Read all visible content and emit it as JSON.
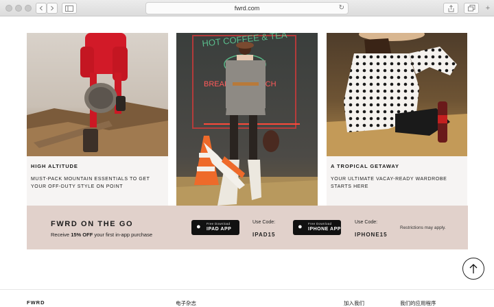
{
  "browser": {
    "url": "fwrd.com",
    "back_icon": "chevron-left-icon",
    "forward_icon": "chevron-right-icon",
    "sidebar_icon": "sidebar-icon",
    "reload_icon": "reload-icon",
    "share_icon": "share-icon",
    "tabs_icon": "tabs-icon",
    "new_tab_icon": "plus-icon"
  },
  "cards": [
    {
      "title": "HIGH ALTITUDE",
      "text": "MUST-PACK MOUNTAIN ESSENTIALS TO GET YOUR OFF-DUTY STYLE ON POINT"
    },
    {
      "neon_top": "HOT COFFEE & TEA",
      "neon_bottom": "BREAKFAST LUNCH"
    },
    {
      "title": "A TROPICAL GETAWAY",
      "text": "YOUR ULTIMATE VACAY-READY WARDROBE STARTS HERE"
    }
  ],
  "promo": {
    "title": "FWRD ON THE GO",
    "sub_prefix": "Receive ",
    "sub_bold": "15% OFF",
    "sub_suffix": " your first in-app purchase",
    "ipad_small": "Free Download",
    "ipad_big": "IPAD APP",
    "ipad_use_label": "Use Code:",
    "ipad_code": "IPAD15",
    "iphone_small": "Free Download",
    "iphone_big": "IPHONE APP",
    "iphone_use_label": "Use Code:",
    "iphone_code": "IPHONE15",
    "restrictions": "Restrictions may apply.",
    "accent": "#e1d1cb"
  },
  "scroll_top_icon": "arrow-up-icon",
  "footer": {
    "brand": "FWRD",
    "magazine": "电子杂志",
    "join": "加入我们",
    "apps": "我们的应用程序"
  }
}
